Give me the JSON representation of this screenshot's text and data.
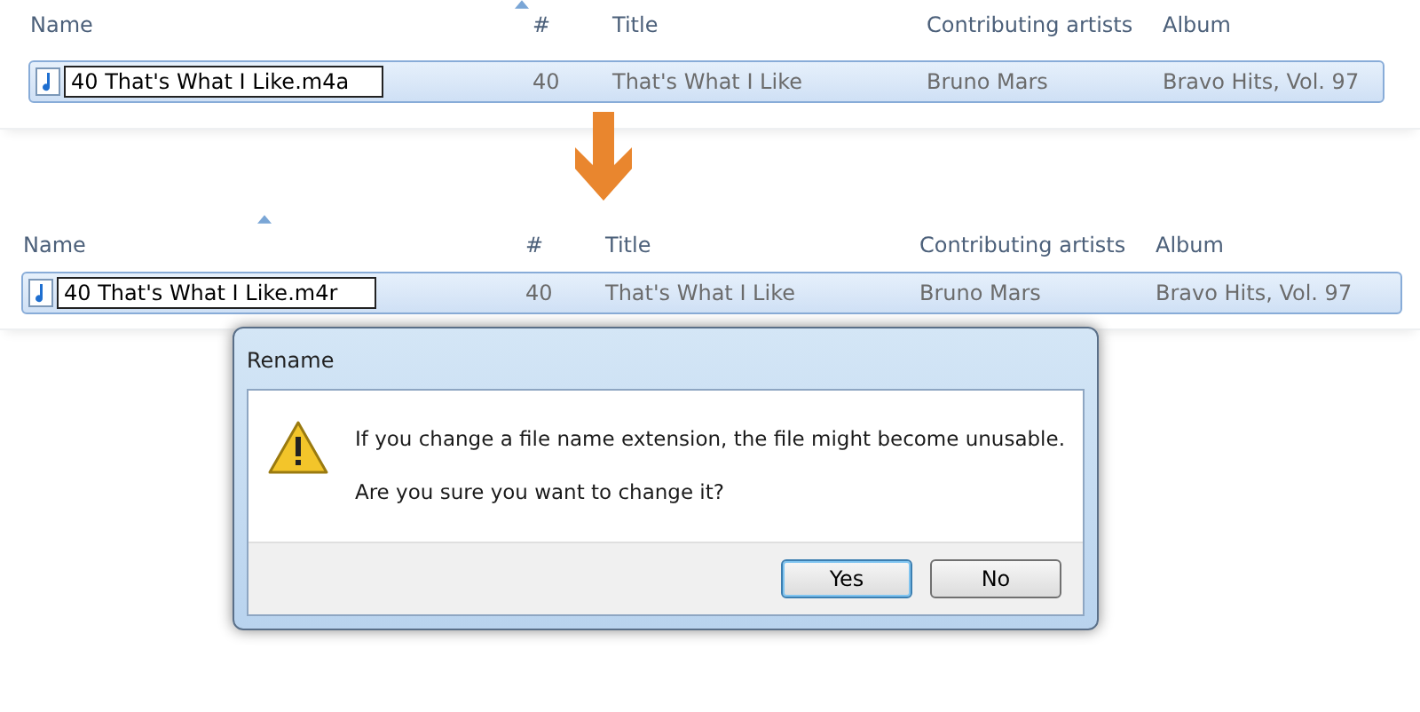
{
  "views": [
    {
      "columns": [
        "Name",
        "#",
        "Title",
        "Contributing artists",
        "Album"
      ],
      "row": {
        "name": "40 That's What I Like.m4a",
        "number": "40",
        "title": "That's What I Like",
        "artists": "Bruno Mars",
        "album": "Bravo Hits, Vol. 97",
        "selected": true
      }
    },
    {
      "columns": [
        "Name",
        "#",
        "Title",
        "Contributing artists",
        "Album"
      ],
      "row": {
        "name": "40 That's What I Like.m4r",
        "number": "40",
        "title": "That's What I Like",
        "artists": "Bruno Mars",
        "album": "Bravo Hits, Vol. 97",
        "selected": true
      }
    }
  ],
  "dialog": {
    "title": "Rename",
    "message": "If you change a file name extension, the file might become unusable.",
    "question": "Are you sure you want to change it?",
    "buttons": [
      {
        "label": "Yes",
        "default": true
      },
      {
        "label": "No",
        "default": false
      }
    ]
  }
}
